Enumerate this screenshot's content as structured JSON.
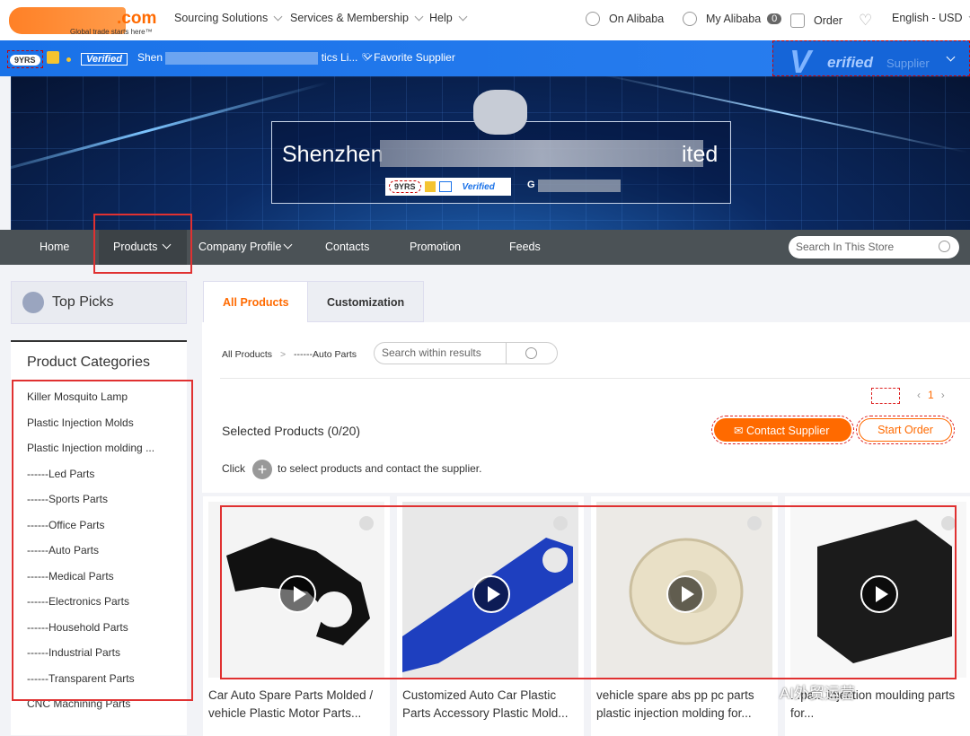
{
  "topbar": {
    "logo_suffix": ".com",
    "logo_tagline": "Global trade starts here™",
    "nav": [
      "Sourcing Solutions",
      "Services & Membership",
      "Help"
    ],
    "on_alibaba": "On Alibaba",
    "my_alibaba": "My Alibaba",
    "my_alibaba_count": "0",
    "order": "Order",
    "language": "English - USD"
  },
  "supplier_bar": {
    "years": "9YRS",
    "verified": "Verified",
    "name_start": "Shen",
    "name_end": "tics Li...",
    "favorite": "Favorite Supplier",
    "verified_supplier_v": "V",
    "verified_supplier_word": "erified",
    "verified_supplier_label": "Supplier"
  },
  "banner": {
    "company_start": "Shenzhen",
    "company_end": "ited",
    "years": "9YRS",
    "verified": "Verified",
    "gold_start": "G"
  },
  "main_nav": {
    "items": [
      "Home",
      "Products",
      "Company Profile",
      "Contacts",
      "Promotion",
      "Feeds"
    ],
    "search_placeholder": "Search In This Store"
  },
  "left": {
    "top_picks": "Top Picks",
    "categories_title": "Product Categories",
    "categories": [
      "Killer Mosquito Lamp",
      "Plastic Injection Molds",
      "Plastic Injection molding ...",
      "------Led Parts",
      "------Sports Parts",
      "------Office Parts",
      "------Auto Parts",
      "------Medical Parts",
      "------Electronics Parts",
      "------Household Parts",
      "------Industrial Parts",
      "------Transparent Parts",
      "CNC Machining Parts"
    ]
  },
  "content": {
    "tabs": [
      "All Products",
      "Customization"
    ],
    "breadcrumb_root": "All Products",
    "breadcrumb_sep": ">",
    "breadcrumb_leaf": "------Auto Parts",
    "search_placeholder": "Search within results",
    "page": "1",
    "selected": "Selected Products (0/20)",
    "contact_supplier": "Contact Supplier",
    "start_order": "Start Order",
    "click_hint_pre": "Click",
    "click_hint_post": "to select products and contact the supplier."
  },
  "products": [
    {
      "title": "Car Auto Spare Parts Molded / vehicle Plastic Motor Parts..."
    },
    {
      "title": "Customized Auto Car Plastic Parts Accessory Plastic Mold..."
    },
    {
      "title": "vehicle spare abs pp pc parts plastic injection molding for..."
    },
    {
      "title": "...pa... injection moulding parts for..."
    }
  ],
  "watermark": "AI外贸运营",
  "colors": {
    "accent": "#ff6a00",
    "blue": "#1a72e8",
    "nav": "#4b5256",
    "highlight": "#e03131"
  }
}
